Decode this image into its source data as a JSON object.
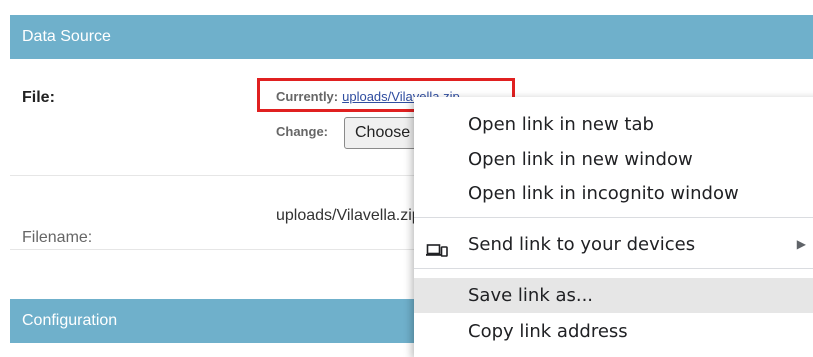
{
  "data_source_header": "Data Source",
  "file_row": {
    "label": "File:",
    "currently_label": "Currently:",
    "currently_link": "uploads/Vilavella.zip",
    "change_label": "Change:",
    "choose_button": "Choose File"
  },
  "filename_row": {
    "label": "Filename:",
    "value": "uploads/Vilavella.zip"
  },
  "configuration_header": "Configuration",
  "context_menu": {
    "items": [
      {
        "label": "Open link in new tab"
      },
      {
        "label": "Open link in new window"
      },
      {
        "label": "Open link in incognito window"
      },
      {
        "label": "Send link to your devices",
        "icon": "devices-icon",
        "submenu": true
      },
      {
        "label": "Save link as...",
        "highlighted": true
      },
      {
        "label": "Copy link address"
      }
    ]
  },
  "colors": {
    "header_bg": "#6fb0cb",
    "highlight_box": "#e02020",
    "link": "#2f4da0",
    "menu_hover": "#e6e6e6"
  }
}
